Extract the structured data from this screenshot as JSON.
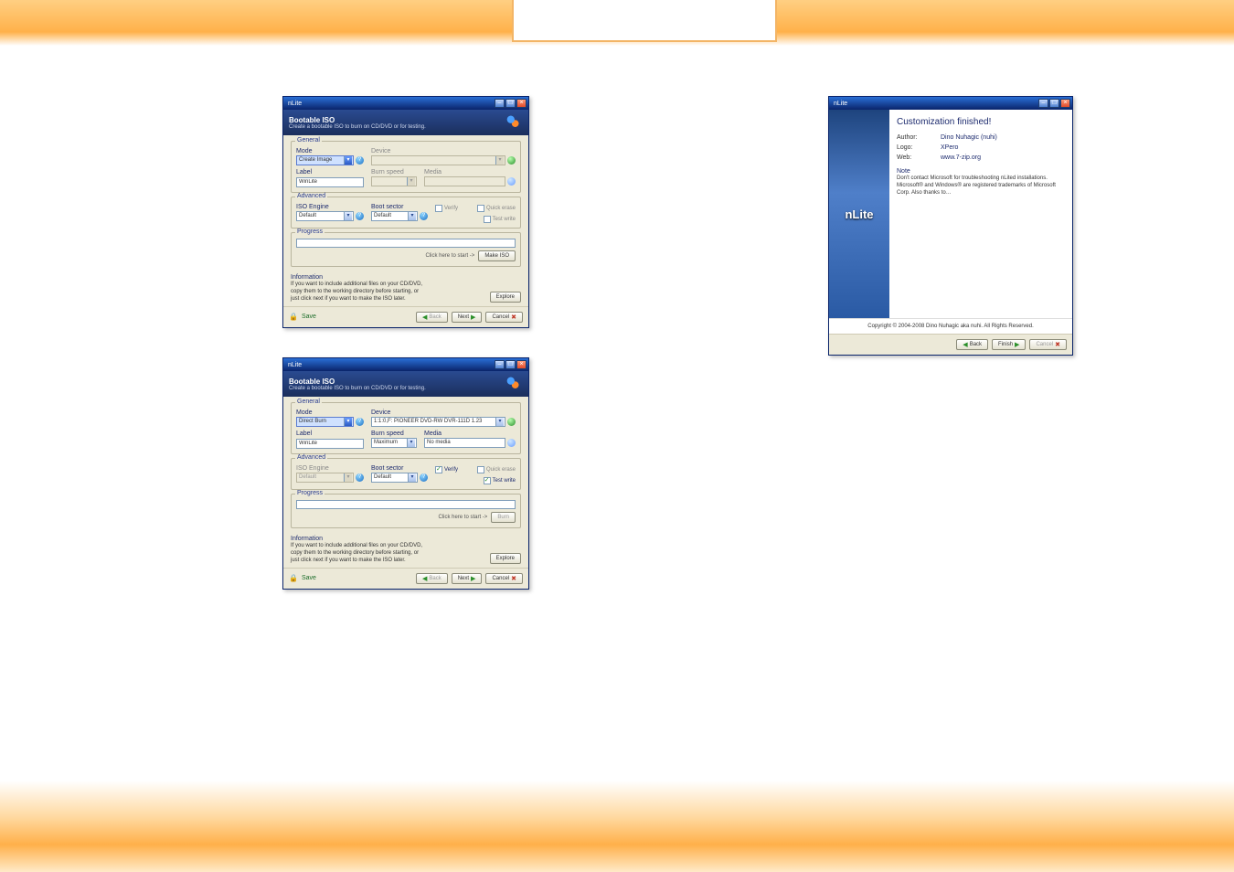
{
  "backdrop": {},
  "dialog1": {
    "title": "nLite",
    "header_title": "Bootable ISO",
    "header_sub": "Create a bootable ISO to burn on CD/DVD or for testing.",
    "general_legend": "General",
    "mode_label": "Mode",
    "mode_value": "Create Image",
    "device_label": "Device",
    "device_value": "",
    "label_label": "Label",
    "label_value": "WinLite",
    "burnspeed_label": "Burn speed",
    "burnspeed_value": "",
    "media_label": "Media",
    "media_value": "",
    "advanced_legend": "Advanced",
    "iso_label": "ISO Engine",
    "iso_value": "Default",
    "boot_label": "Boot sector",
    "boot_value": "Default",
    "verify_label": "Verify",
    "quick_label": "Quick erase",
    "test_label": "Test write",
    "progress_legend": "Progress",
    "click_start": "Click here to start ->",
    "make_iso_btn": "Make ISO",
    "info_title": "Information",
    "info_text": "If you want to include additional files on your CD/DVD, copy them to the working directory before starting, or just click next if you want to make the ISO later.",
    "explore_btn": "Explore",
    "save_btn": "Save",
    "back_btn": "Back",
    "next_btn": "Next",
    "cancel_btn": "Cancel"
  },
  "dialog2": {
    "title": "nLite",
    "header_title": "Bootable ISO",
    "header_sub": "Create a bootable ISO to burn on CD/DVD or for testing.",
    "general_legend": "General",
    "mode_label": "Mode",
    "mode_value": "Direct Burn",
    "device_label": "Device",
    "device_value": "1:1:0,F: PIONEER  DVD-RW  DVR-111D 1.23",
    "label_label": "Label",
    "label_value": "WinLite",
    "burnspeed_label": "Burn speed",
    "burnspeed_value": "Maximum",
    "media_label": "Media",
    "media_value": "No media",
    "advanced_legend": "Advanced",
    "iso_label": "ISO Engine",
    "iso_value": "Default",
    "boot_label": "Boot sector",
    "boot_value": "Default",
    "verify_label": "Verify",
    "quick_label": "Quick erase",
    "test_label": "Test write",
    "progress_legend": "Progress",
    "click_start": "Click here to start ->",
    "burn_btn": "Burn",
    "info_title": "Information",
    "info_text": "If you want to include additional files on your CD/DVD, copy them to the working directory before starting, or just click next if you want to make the ISO later.",
    "explore_btn": "Explore",
    "save_btn": "Save",
    "back_btn": "Back",
    "next_btn": "Next",
    "cancel_btn": "Cancel"
  },
  "dialog3": {
    "title": "nLite",
    "brand": "nLite",
    "finished_title": "Customization finished!",
    "author_k": "Author:",
    "author_v": "Dino Nuhagic (nuhi)",
    "logo_k": "Logo:",
    "logo_v": "XPero",
    "web_k": "Web:",
    "web_v": "www.7-zip.org",
    "note_title": "Note",
    "note_body": "Don't contact Microsoft for troubleshooting nLited installations. Microsoft® and Windows® are registered trademarks of Microsoft Corp.\nAlso thanks to…",
    "copyright": "Copyright © 2004-2008 Dino Nuhagic aka nuhi. All Rights Reserved.",
    "back_btn": "Back",
    "finish_btn": "Finish",
    "cancel_btn": "Cancel"
  }
}
